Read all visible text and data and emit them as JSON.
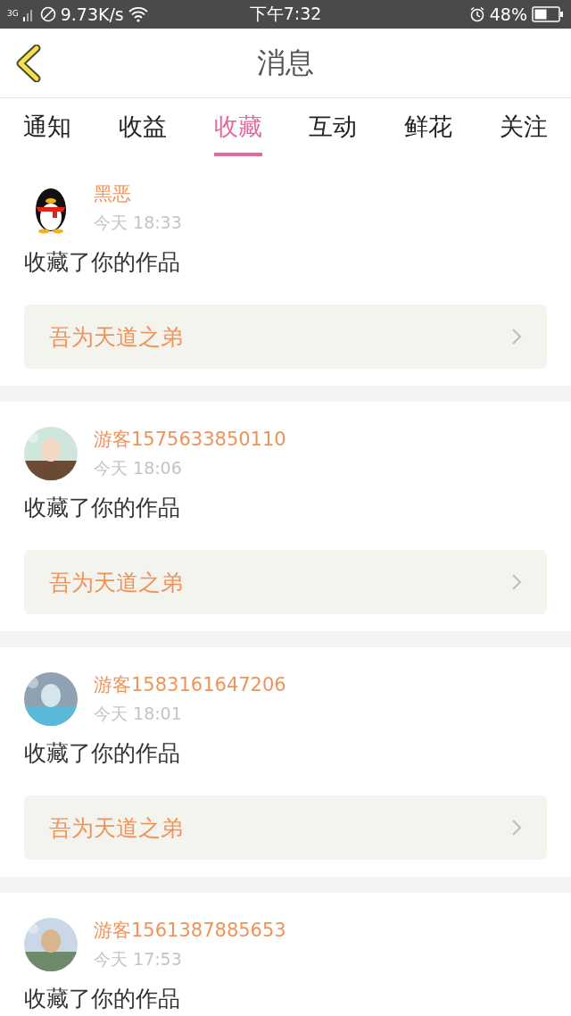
{
  "status_bar": {
    "network": "3G",
    "speed": "9.73K/s",
    "time": "下午7:32",
    "battery": "48%"
  },
  "header": {
    "title": "消息"
  },
  "tabs": [
    {
      "label": "通知",
      "selected": false
    },
    {
      "label": "收益",
      "selected": false
    },
    {
      "label": "收藏",
      "selected": true
    },
    {
      "label": "互动",
      "selected": false
    },
    {
      "label": "鲜花",
      "selected": false
    },
    {
      "label": "关注",
      "selected": false
    }
  ],
  "messages": [
    {
      "avatar": {
        "kind": "penguin"
      },
      "name": "黑恶",
      "time": "今天 18:33",
      "text": "收藏了你的作品",
      "work": "吾为天道之弟"
    },
    {
      "name": "游客1575633850110",
      "time": "今天 18:06",
      "text": "收藏了你的作品",
      "work": "吾为天道之弟"
    },
    {
      "name": "游客1583161647206",
      "time": "今天 18:01",
      "text": "收藏了你的作品",
      "work": "吾为天道之弟"
    },
    {
      "name": "游客1561387885653",
      "time": "今天 17:53",
      "text": "收藏了你的作品"
    }
  ]
}
